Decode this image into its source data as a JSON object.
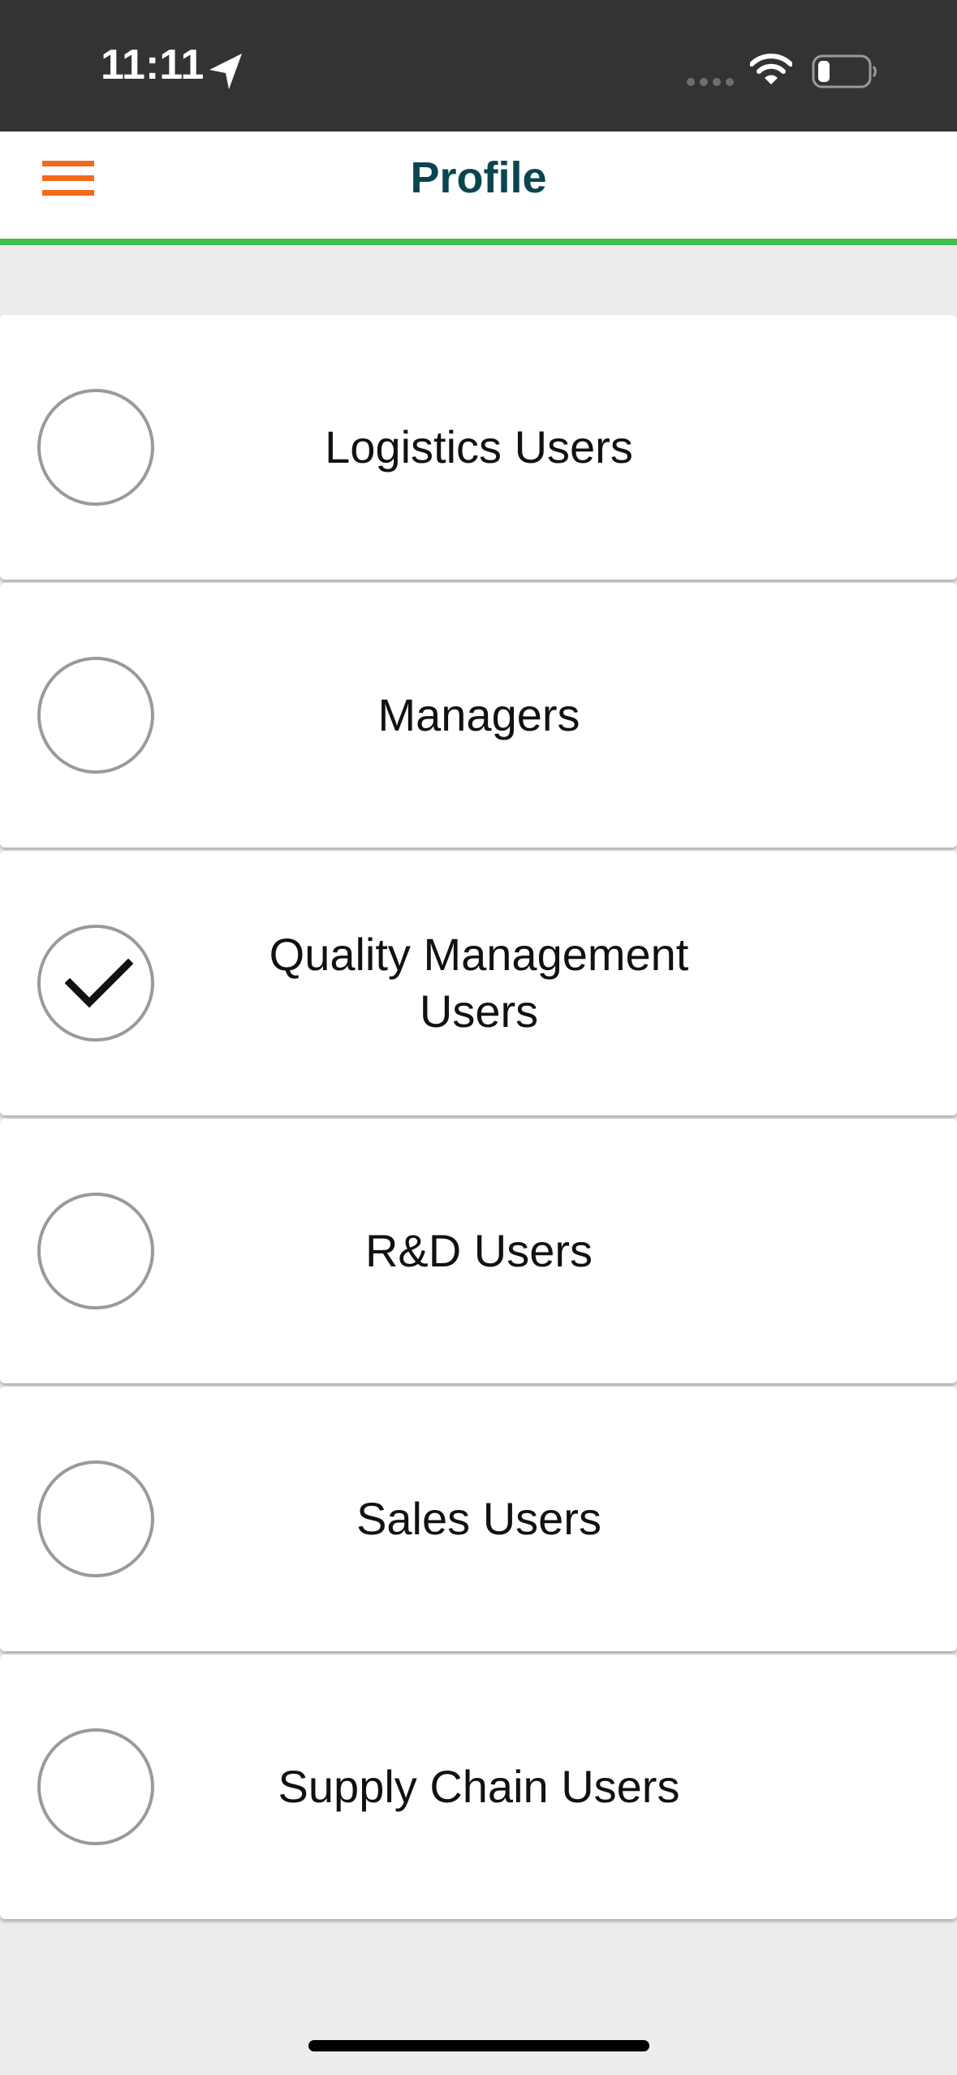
{
  "status_bar": {
    "time": "11:11",
    "icons": [
      "location-arrow-icon",
      "cellular-signal-icon",
      "wifi-icon",
      "battery-icon"
    ]
  },
  "header": {
    "title": "Profile",
    "menu_icon": "hamburger-menu-icon"
  },
  "colors": {
    "status_bar_bg": "#333333",
    "title": "#0b4550",
    "menu_icon": "#f26a1b",
    "header_divider": "#3cbf4f",
    "page_bg": "#ededed"
  },
  "profiles": [
    {
      "label": "Logistics Users",
      "selected": false
    },
    {
      "label": "Managers",
      "selected": false
    },
    {
      "label": "Quality Management Users",
      "selected": true
    },
    {
      "label": "R&D Users",
      "selected": false
    },
    {
      "label": "Sales Users",
      "selected": false
    },
    {
      "label": "Supply Chain Users",
      "selected": false
    }
  ]
}
